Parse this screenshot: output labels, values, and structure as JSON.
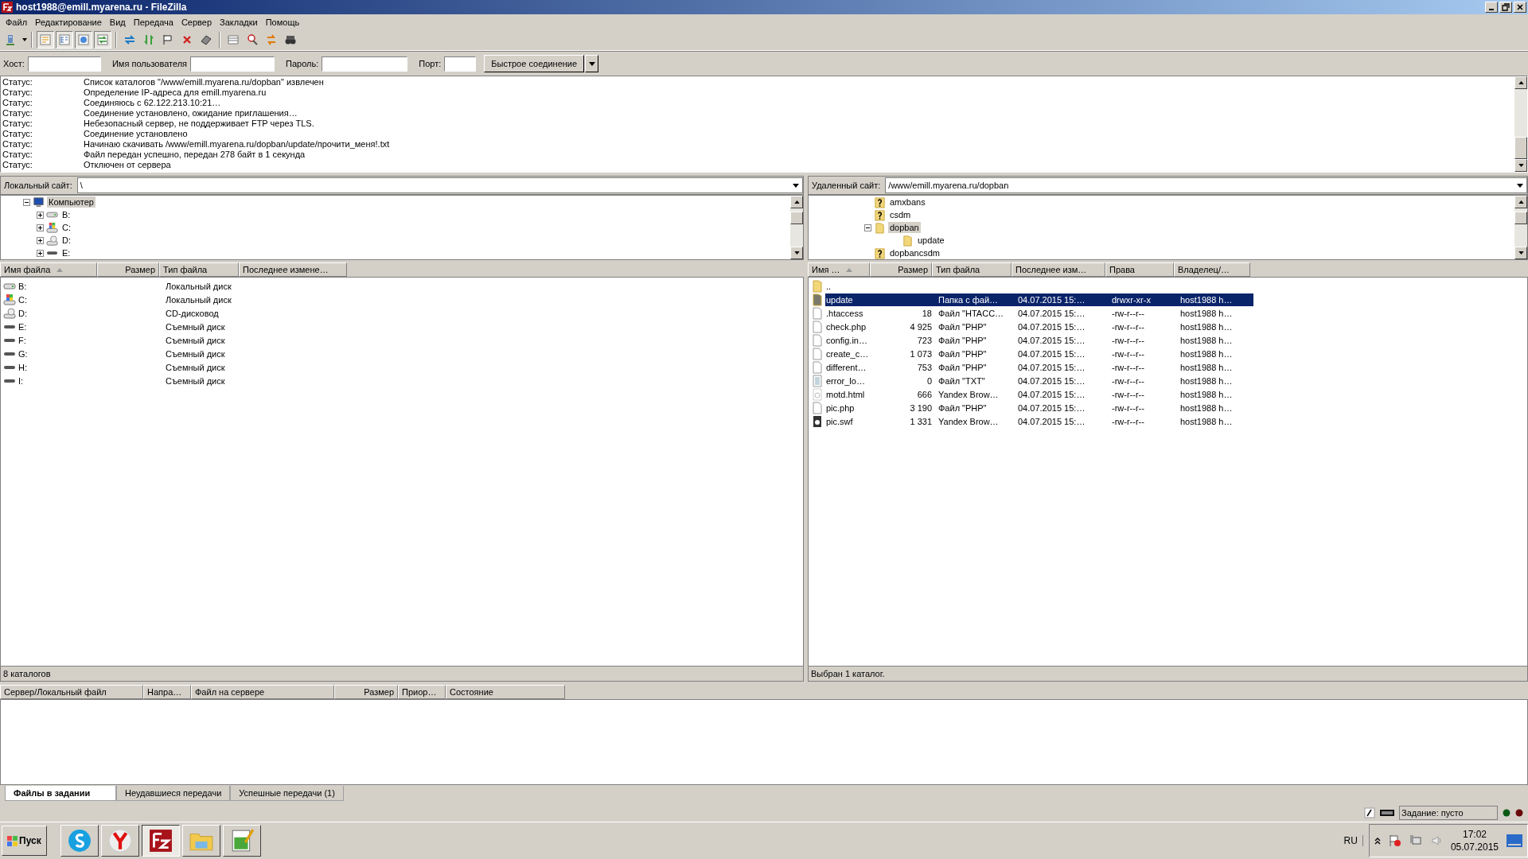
{
  "window": {
    "title": "host1988@emill.myarena.ru - FileZilla"
  },
  "menu": [
    "Файл",
    "Редактирование",
    "Вид",
    "Передача",
    "Сервер",
    "Закладки",
    "Помощь"
  ],
  "toolbar_toggles": [
    {
      "on": true
    },
    {
      "on": true
    },
    {
      "on": true
    },
    {
      "on": true
    }
  ],
  "quickconnect": {
    "fields": [
      {
        "label": "Хост:"
      },
      {
        "label": "Имя пользователя"
      },
      {
        "label": "Пароль:"
      },
      {
        "label": "Порт:"
      }
    ],
    "button": "Быстрое соединение"
  },
  "log": [
    {
      "label": "Статус:",
      "message": "Список каталогов \"/www/emill.myarena.ru/dopban\" извлечен"
    },
    {
      "label": "Статус:",
      "message": "Определение IP-адреса для emill.myarena.ru"
    },
    {
      "label": "Статус:",
      "message": "Соединяюсь с 62.122.213.10:21…"
    },
    {
      "label": "Статус:",
      "message": "Соединение установлено, ожидание приглашения…"
    },
    {
      "label": "Статус:",
      "message": "Небезопасный сервер, не поддерживает FTP через TLS."
    },
    {
      "label": "Статус:",
      "message": "Соединение установлено"
    },
    {
      "label": "Статус:",
      "message": "Начинаю скачивать /www/emill.myarena.ru/dopban/update/прочити_меня!.txt"
    },
    {
      "label": "Статус:",
      "message": "Файл передан успешно, передан 278 байт в 1 секунда"
    },
    {
      "label": "Статус:",
      "message": "Отключен от сервера"
    }
  ],
  "local": {
    "site_label": "Локальный сайт:",
    "path": "\\",
    "tree": [
      {
        "label": "Компьютер",
        "kind": "computer",
        "selected": true,
        "expanded": true,
        "children": [
          {
            "label": "B:",
            "kind": "hdd",
            "selected": false,
            "expanded": false
          },
          {
            "label": "C:",
            "kind": "system",
            "selected": false,
            "expanded": false
          },
          {
            "label": "D:",
            "kind": "cd",
            "selected": false,
            "expanded": false
          },
          {
            "label": "E:",
            "kind": "removable",
            "selected": false,
            "expanded": false
          }
        ]
      }
    ],
    "columns": [
      {
        "label": "Имя файла",
        "sorted": true
      },
      {
        "label": "Размер",
        "sorted": false
      },
      {
        "label": "Тип файла",
        "sorted": false
      },
      {
        "label": "Последнее измене…",
        "sorted": false
      }
    ],
    "rows": [
      {
        "kind": "hdd",
        "selected": false,
        "cells": [
          "B:",
          "",
          "Локальный диск",
          ""
        ]
      },
      {
        "kind": "system",
        "selected": false,
        "cells": [
          "C:",
          "",
          "Локальный диск",
          ""
        ]
      },
      {
        "kind": "cd",
        "selected": false,
        "cells": [
          "D:",
          "",
          "CD-дисковод",
          ""
        ]
      },
      {
        "kind": "removable",
        "selected": false,
        "cells": [
          "E:",
          "",
          "Съемный диск",
          ""
        ]
      },
      {
        "kind": "removable",
        "selected": false,
        "cells": [
          "F:",
          "",
          "Съемный диск",
          ""
        ]
      },
      {
        "kind": "removable",
        "selected": false,
        "cells": [
          "G:",
          "",
          "Съемный диск",
          ""
        ]
      },
      {
        "kind": "removable",
        "selected": false,
        "cells": [
          "H:",
          "",
          "Съемный диск",
          ""
        ]
      },
      {
        "kind": "removable",
        "selected": false,
        "cells": [
          "I:",
          "",
          "Съемный диск",
          ""
        ]
      }
    ],
    "status": "8 каталогов"
  },
  "remote": {
    "site_label": "Удаленный сайт:",
    "path": "/www/emill.myarena.ru/dopban",
    "tree": [
      {
        "label": "amxbans",
        "kind": "unknown",
        "selected": false
      },
      {
        "label": "csdm",
        "kind": "unknown",
        "selected": false
      },
      {
        "label": "dopban",
        "kind": "folder",
        "selected": true,
        "expanded": true,
        "children": [
          {
            "label": "update",
            "kind": "folder",
            "selected": false
          }
        ]
      },
      {
        "label": "dopbancsdm",
        "kind": "unknown",
        "selected": false
      }
    ],
    "columns": [
      {
        "label": "Имя …",
        "sorted": true
      },
      {
        "label": "Размер",
        "sorted": false
      },
      {
        "label": "Тип файла",
        "sorted": false
      },
      {
        "label": "Последнее изм…",
        "sorted": false
      },
      {
        "label": "Права",
        "sorted": false
      },
      {
        "label": "Владелец/…",
        "sorted": false
      }
    ],
    "rows": [
      {
        "kind": "parent",
        "selected": false,
        "cells": [
          "..",
          "",
          "",
          "",
          "",
          ""
        ]
      },
      {
        "kind": "folder",
        "selected": true,
        "cells": [
          "update",
          "",
          "Папка с фай…",
          "04.07.2015 15:…",
          "drwxr-xr-x",
          "host1988 h…"
        ]
      },
      {
        "kind": "file",
        "selected": false,
        "cells": [
          ".htaccess",
          "18",
          "Файл \"HTACC…",
          "04.07.2015 15:…",
          "-rw-r--r--",
          "host1988 h…"
        ]
      },
      {
        "kind": "file",
        "selected": false,
        "cells": [
          "check.php",
          "4 925",
          "Файл \"PHP\"",
          "04.07.2015 15:…",
          "-rw-r--r--",
          "host1988 h…"
        ]
      },
      {
        "kind": "file",
        "selected": false,
        "cells": [
          "config.in…",
          "723",
          "Файл \"PHP\"",
          "04.07.2015 15:…",
          "-rw-r--r--",
          "host1988 h…"
        ]
      },
      {
        "kind": "file",
        "selected": false,
        "cells": [
          "create_c…",
          "1 073",
          "Файл \"PHP\"",
          "04.07.2015 15:…",
          "-rw-r--r--",
          "host1988 h…"
        ]
      },
      {
        "kind": "file",
        "selected": false,
        "cells": [
          "different…",
          "753",
          "Файл \"PHP\"",
          "04.07.2015 15:…",
          "-rw-r--r--",
          "host1988 h…"
        ]
      },
      {
        "kind": "text",
        "selected": false,
        "cells": [
          "error_lo…",
          "0",
          "Файл \"TXT\"",
          "04.07.2015 15:…",
          "-rw-r--r--",
          "host1988 h…"
        ]
      },
      {
        "kind": "browser",
        "selected": false,
        "cells": [
          "motd.html",
          "666",
          "Yandex Brow…",
          "04.07.2015 15:…",
          "-rw-r--r--",
          "host1988 h…"
        ]
      },
      {
        "kind": "file",
        "selected": false,
        "cells": [
          "pic.php",
          "3 190",
          "Файл \"PHP\"",
          "04.07.2015 15:…",
          "-rw-r--r--",
          "host1988 h…"
        ]
      },
      {
        "kind": "flash",
        "selected": false,
        "cells": [
          "pic.swf",
          "1 331",
          "Yandex Brow…",
          "04.07.2015 15:…",
          "-rw-r--r--",
          "host1988 h…"
        ]
      }
    ],
    "status": "Выбран 1 каталог."
  },
  "queue": {
    "columns": [
      "Сервер/Локальный файл",
      "Напра…",
      "Файл на сервере",
      "Размер",
      "Приор…",
      "Состояние"
    ],
    "tabs": [
      {
        "label": "Файлы в задании",
        "selected": true
      },
      {
        "label": "Неудавшиеся передачи",
        "selected": false
      },
      {
        "label": "Успешные передачи (1)",
        "selected": false
      }
    ]
  },
  "status_bar": {
    "queue": "Задание: пусто"
  },
  "taskbar": {
    "start": "Пуск",
    "apps": [
      {
        "kind": "chat",
        "selected": false
      },
      {
        "kind": "browser",
        "selected": false
      },
      {
        "kind": "ftp",
        "selected": true
      },
      {
        "kind": "explorer",
        "selected": false
      },
      {
        "kind": "editor",
        "selected": false
      }
    ],
    "language": "RU",
    "time": "17:02",
    "date": "05.07.2015"
  }
}
